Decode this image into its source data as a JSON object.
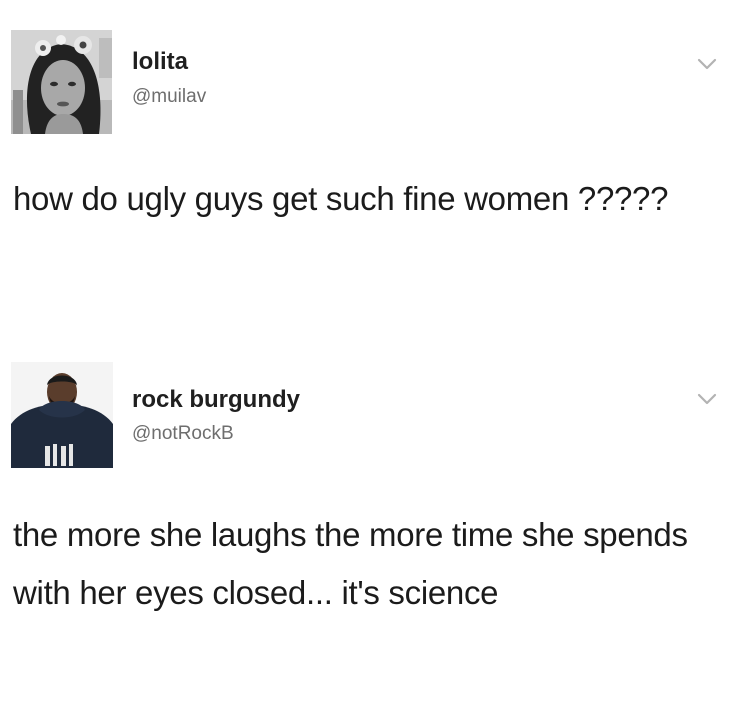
{
  "tweets": [
    {
      "display_name": "lolita",
      "handle": "@muilav",
      "text": "how do ugly guys get such fine women ?????",
      "menu_icon": "chevron-down-icon"
    },
    {
      "display_name": "rock burgundy",
      "handle": "@notRockB",
      "text": "the more she laughs the more time she spends with her eyes closed... it's science",
      "menu_icon": "chevron-down-icon"
    }
  ]
}
